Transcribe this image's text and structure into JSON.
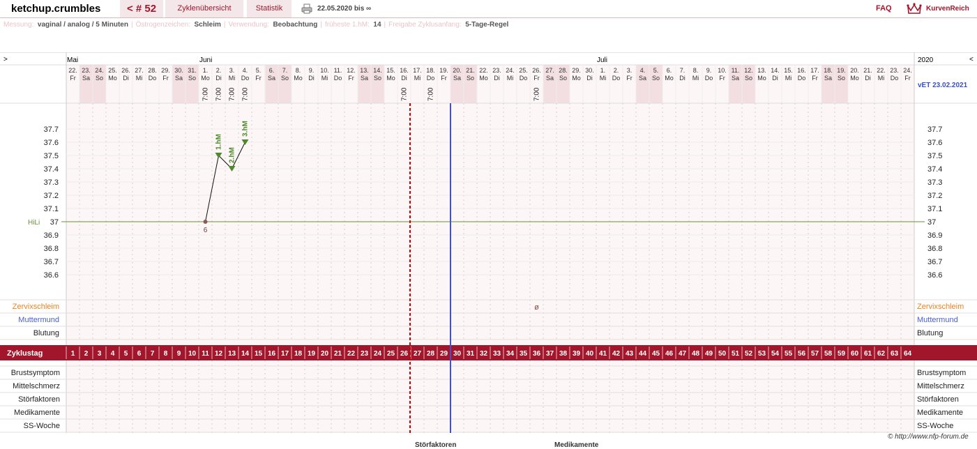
{
  "header": {
    "username": "ketchup.crumbles",
    "cycle_number": "< # 52",
    "cycle_overview": "Zyklenübersicht",
    "statistics": "Statistik",
    "date_range": "22.05.2020 bis ∞",
    "faq": "FAQ",
    "brand": "KurvenReich"
  },
  "settings": [
    {
      "label": "Messung:",
      "value": "vaginal / analog / 5 Minuten"
    },
    {
      "label": "Östrogenzeichen:",
      "value": "Schleim"
    },
    {
      "label": "Verwendung:",
      "value": "Beobachtung"
    },
    {
      "label": "früheste 1.hM:",
      "value": "14"
    },
    {
      "label": "Freigabe Zyklusanfang:",
      "value": "5-Tage-Regel"
    }
  ],
  "chart_data": {
    "type": "line",
    "year": "2020",
    "months": [
      {
        "name": "Mai",
        "start_index": 0
      },
      {
        "name": "Juni",
        "start_index": 10
      },
      {
        "name": "Juli",
        "start_index": 40
      }
    ],
    "days": [
      {
        "d": "22.",
        "w": "Fr"
      },
      {
        "d": "23.",
        "w": "Sa"
      },
      {
        "d": "24.",
        "w": "So"
      },
      {
        "d": "25.",
        "w": "Mo"
      },
      {
        "d": "26.",
        "w": "Di"
      },
      {
        "d": "27.",
        "w": "Mi"
      },
      {
        "d": "28.",
        "w": "Do"
      },
      {
        "d": "29.",
        "w": "Fr"
      },
      {
        "d": "30.",
        "w": "Sa"
      },
      {
        "d": "31.",
        "w": "So"
      },
      {
        "d": "1.",
        "w": "Mo"
      },
      {
        "d": "2.",
        "w": "Di"
      },
      {
        "d": "3.",
        "w": "Mi"
      },
      {
        "d": "4.",
        "w": "Do"
      },
      {
        "d": "5.",
        "w": "Fr"
      },
      {
        "d": "6.",
        "w": "Sa"
      },
      {
        "d": "7.",
        "w": "So"
      },
      {
        "d": "8.",
        "w": "Mo"
      },
      {
        "d": "9.",
        "w": "Di"
      },
      {
        "d": "10.",
        "w": "Mi"
      },
      {
        "d": "11.",
        "w": "Do"
      },
      {
        "d": "12.",
        "w": "Fr"
      },
      {
        "d": "13.",
        "w": "Sa"
      },
      {
        "d": "14.",
        "w": "So"
      },
      {
        "d": "15.",
        "w": "Mo"
      },
      {
        "d": "16.",
        "w": "Di"
      },
      {
        "d": "17.",
        "w": "Mi"
      },
      {
        "d": "18.",
        "w": "Do"
      },
      {
        "d": "19.",
        "w": "Fr"
      },
      {
        "d": "20.",
        "w": "Sa"
      },
      {
        "d": "21.",
        "w": "So"
      },
      {
        "d": "22.",
        "w": "Mo"
      },
      {
        "d": "23.",
        "w": "Di"
      },
      {
        "d": "24.",
        "w": "Mi"
      },
      {
        "d": "25.",
        "w": "Do"
      },
      {
        "d": "26.",
        "w": "Fr"
      },
      {
        "d": "27.",
        "w": "Sa"
      },
      {
        "d": "28.",
        "w": "So"
      },
      {
        "d": "29.",
        "w": "Mo"
      },
      {
        "d": "30.",
        "w": "Di"
      },
      {
        "d": "1.",
        "w": "Mi"
      },
      {
        "d": "2.",
        "w": "Do"
      },
      {
        "d": "3.",
        "w": "Fr"
      },
      {
        "d": "4.",
        "w": "Sa"
      },
      {
        "d": "5.",
        "w": "So"
      },
      {
        "d": "6.",
        "w": "Mo"
      },
      {
        "d": "7.",
        "w": "Di"
      },
      {
        "d": "8.",
        "w": "Mi"
      },
      {
        "d": "9.",
        "w": "Do"
      },
      {
        "d": "10.",
        "w": "Fr"
      },
      {
        "d": "11.",
        "w": "Sa"
      },
      {
        "d": "12.",
        "w": "So"
      },
      {
        "d": "13.",
        "w": "Mo"
      },
      {
        "d": "14.",
        "w": "Di"
      },
      {
        "d": "15.",
        "w": "Mi"
      },
      {
        "d": "16.",
        "w": "Do"
      },
      {
        "d": "17.",
        "w": "Fr"
      },
      {
        "d": "18.",
        "w": "Sa"
      },
      {
        "d": "19.",
        "w": "So"
      },
      {
        "d": "20.",
        "w": "Mo"
      },
      {
        "d": "21.",
        "w": "Di"
      },
      {
        "d": "22.",
        "w": "Mi"
      },
      {
        "d": "23.",
        "w": "Do"
      },
      {
        "d": "24.",
        "w": "Fr"
      }
    ],
    "time_labels": [
      {
        "day": 11,
        "time": "7:00"
      },
      {
        "day": 12,
        "time": "7:00"
      },
      {
        "day": 13,
        "time": "7:00"
      },
      {
        "day": 14,
        "time": "7:00"
      },
      {
        "day": 26,
        "time": "7:00"
      },
      {
        "day": 28,
        "time": "7:00"
      },
      {
        "day": 36,
        "time": "7:00"
      }
    ],
    "ylim": [
      36.5,
      37.8
    ],
    "y_ticks": [
      37.7,
      37.6,
      37.5,
      37.4,
      37.3,
      37.2,
      37.1,
      37,
      36.9,
      36.8,
      36.7,
      36.6
    ],
    "hili": {
      "label": "HiLi",
      "value": 37
    },
    "temperatures": [
      {
        "day": 11,
        "value": 37,
        "label": "6"
      },
      {
        "day": 12,
        "value": 37.5,
        "label": "1.hM"
      },
      {
        "day": 13,
        "value": 37.4,
        "label": "2.hM"
      },
      {
        "day": 14,
        "value": 37.6,
        "label": "3.hM"
      }
    ],
    "infertile_marker_day": 27,
    "current_day_marker_day": 30,
    "cycle_days": [
      1,
      2,
      3,
      4,
      5,
      6,
      7,
      8,
      9,
      10,
      11,
      12,
      13,
      14,
      15,
      16,
      17,
      18,
      19,
      20,
      21,
      22,
      23,
      24,
      25,
      26,
      27,
      28,
      29,
      30,
      31,
      32,
      33,
      34,
      35,
      36,
      37,
      38,
      39,
      40,
      41,
      42,
      43,
      44,
      45,
      46,
      47,
      48,
      49,
      50,
      51,
      52,
      53,
      54,
      55,
      56,
      57,
      58,
      59,
      60,
      61,
      62,
      63,
      64
    ],
    "due_date": "vET 23.02.2021",
    "nav_left": ">",
    "nav_right": "<",
    "upper_rows": [
      {
        "label": "Zervixschleim",
        "color": "#ef7f1a"
      },
      {
        "label": "Muttermund",
        "color": "#4a5fc8"
      },
      {
        "label": "Blutung",
        "color": "#222222"
      }
    ],
    "cycle_row_label": "Zyklustag",
    "lower_rows": [
      "Brustsymptom",
      "Mittelschmerz",
      "Störfaktoren",
      "Medikamente",
      "SS-Woche"
    ],
    "mucus_entries": [
      {
        "day": 36,
        "symbol": "ø"
      }
    ]
  },
  "colors": {
    "accent": "#a2162b",
    "weekend": "#f3dfe2",
    "grid_bg": "#fcf6f6",
    "hili_line": "#6b8e3a",
    "temp_marker": "#4f8a2a",
    "current_line": "#3f4fd6",
    "infertile_line": "#cc0000"
  },
  "footer": {
    "copyright": "© http://www.nfp-forum.de",
    "legend_storfaktoren": "Störfaktoren",
    "legend_medikamente": "Medikamente"
  }
}
